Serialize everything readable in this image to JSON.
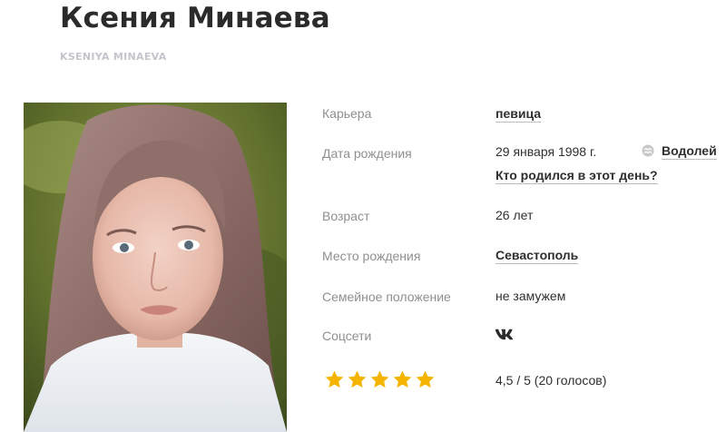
{
  "profile": {
    "name": "Ксения Минаева",
    "name_latin": "KSENIYA MINAEVA"
  },
  "photo": {
    "alt": "Ксения Минаева"
  },
  "fields": {
    "career": {
      "label": "Карьера",
      "value": "певица"
    },
    "birth_date": {
      "label": "Дата рождения",
      "value": "29 января 1998 г.",
      "zodiac": "Водолей",
      "zodiac_icon": "aquarius-icon",
      "link": "Кто родился в этот день?"
    },
    "age": {
      "label": "Возраст",
      "value": "26 лет"
    },
    "birth_place": {
      "label": "Место рождения",
      "value": "Севастополь"
    },
    "marital_status": {
      "label": "Семейное положение",
      "value": "не замужем"
    },
    "social": {
      "label": "Соцсети",
      "icon": "vk-icon"
    }
  },
  "rating": {
    "stars_filled": 5,
    "stars_total": 5,
    "text": "4,5 / 5 (20 голосов)",
    "star_color": "#f5b400"
  }
}
